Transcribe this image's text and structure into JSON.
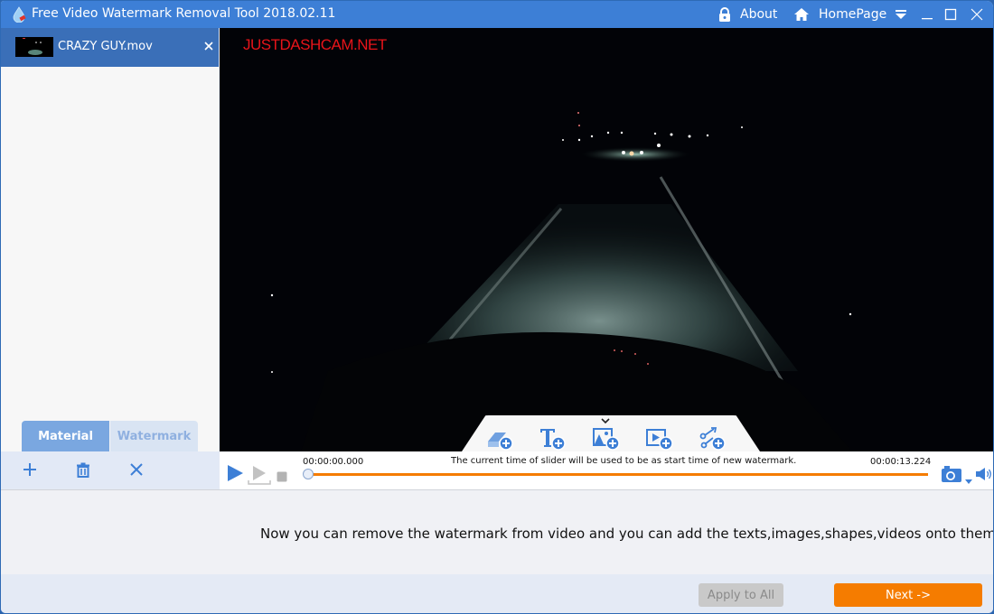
{
  "window": {
    "title": "Free Video Watermark Removal Tool 2018.02.11",
    "about_label": "About",
    "homepage_label": "HomePage",
    "icons": {
      "app": "water-drop-icon",
      "about": "lock-icon",
      "homepage": "home-icon",
      "menu": "dropdown-menu-icon",
      "minimize": "minimize-icon",
      "maximize": "maximize-icon",
      "close": "close-icon"
    }
  },
  "sidebar": {
    "files": [
      {
        "name": "CRAZY GUY.mov",
        "selected": true
      }
    ],
    "tabs": [
      {
        "label": "Material",
        "active": true
      },
      {
        "label": "Watermark",
        "active": false
      }
    ],
    "toolbar": [
      {
        "icon": "plus-icon",
        "action": "add"
      },
      {
        "icon": "trash-icon",
        "action": "delete"
      },
      {
        "icon": "close-icon",
        "action": "clear"
      }
    ]
  },
  "video": {
    "overlay_watermark": "JUSTDASHCAM.NET",
    "tools": [
      {
        "icon": "eraser-add-icon",
        "action": "remove-watermark"
      },
      {
        "icon": "text-add-icon",
        "action": "add-text"
      },
      {
        "icon": "image-add-icon",
        "action": "add-image"
      },
      {
        "icon": "video-add-icon",
        "action": "add-video"
      },
      {
        "icon": "shape-add-icon",
        "action": "add-shape"
      }
    ]
  },
  "player": {
    "current_time": "00:00:00.000",
    "end_time": "00:00:13.224",
    "hint": "The current time of slider will be used to be as start time of new watermark.",
    "progress": 0,
    "colors": {
      "accent": "#3d7fd6",
      "track": "#f57c00"
    }
  },
  "message": "Now you can remove the watermark from video and you can add the texts,images,shapes,videos onto them.",
  "footer": {
    "apply_all_label": "Apply to All",
    "next_label": "Next ->",
    "colors": {
      "next": "#f57c00",
      "apply_disabled": "#c9c9c9"
    }
  }
}
